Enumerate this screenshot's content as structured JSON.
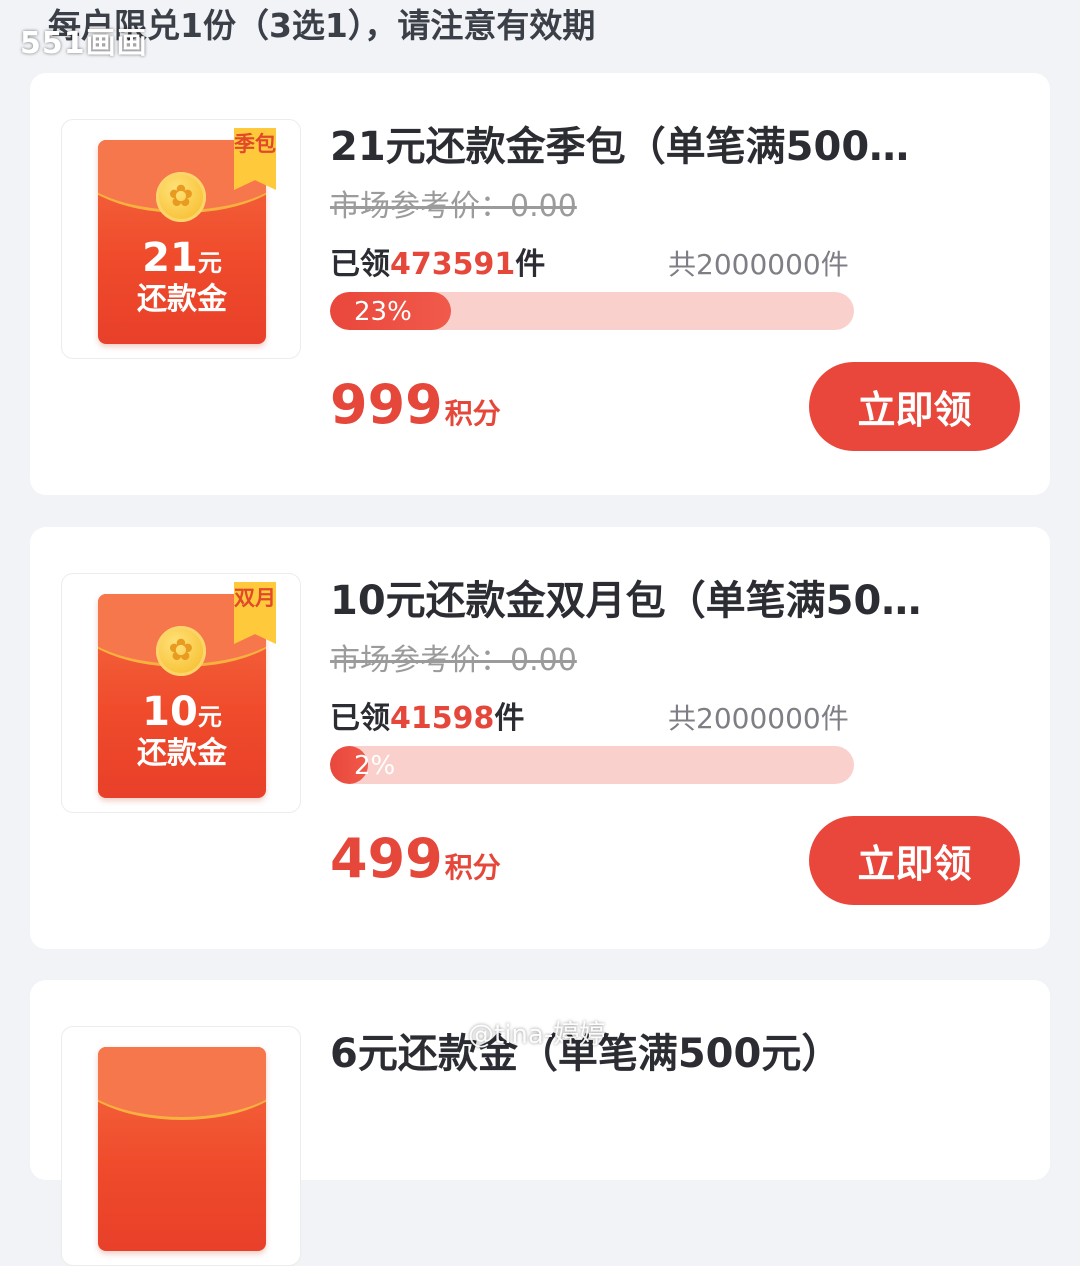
{
  "header": {
    "notice": "每户限兑1份（3选1），请注意有效期",
    "watermark_top": "551画画"
  },
  "colors": {
    "accent": "#e9473c",
    "progress_track": "#fad0cd",
    "ribbon": "#ffc93c",
    "page_bg": "#f1f3f6"
  },
  "products": [
    {
      "title": "21元还款金季包（单笔满500…",
      "badge": "季包",
      "image_amount": "21",
      "image_unit": "元",
      "image_label": "还款金",
      "market_price": "市场参考价：0.00",
      "claimed_prefix": "已领",
      "claimed_count": "473591",
      "claimed_suffix": "件",
      "total": "共2000000件",
      "progress_text": "23%",
      "progress_value": 0.23,
      "points_value": "999",
      "points_unit": "积分",
      "button_label": "立即领"
    },
    {
      "title": "10元还款金双月包（单笔满50…",
      "badge": "双月",
      "image_amount": "10",
      "image_unit": "元",
      "image_label": "还款金",
      "market_price": "市场参考价：0.00",
      "claimed_prefix": "已领",
      "claimed_count": "41598",
      "claimed_suffix": "件",
      "total": "共2000000件",
      "progress_text": "2%",
      "progress_value": 0.02,
      "points_value": "499",
      "points_unit": "积分",
      "button_label": "立即领"
    },
    {
      "title": "6元还款金（单笔满500元）"
    }
  ],
  "watermark_bottom": "@tina-婷婷"
}
